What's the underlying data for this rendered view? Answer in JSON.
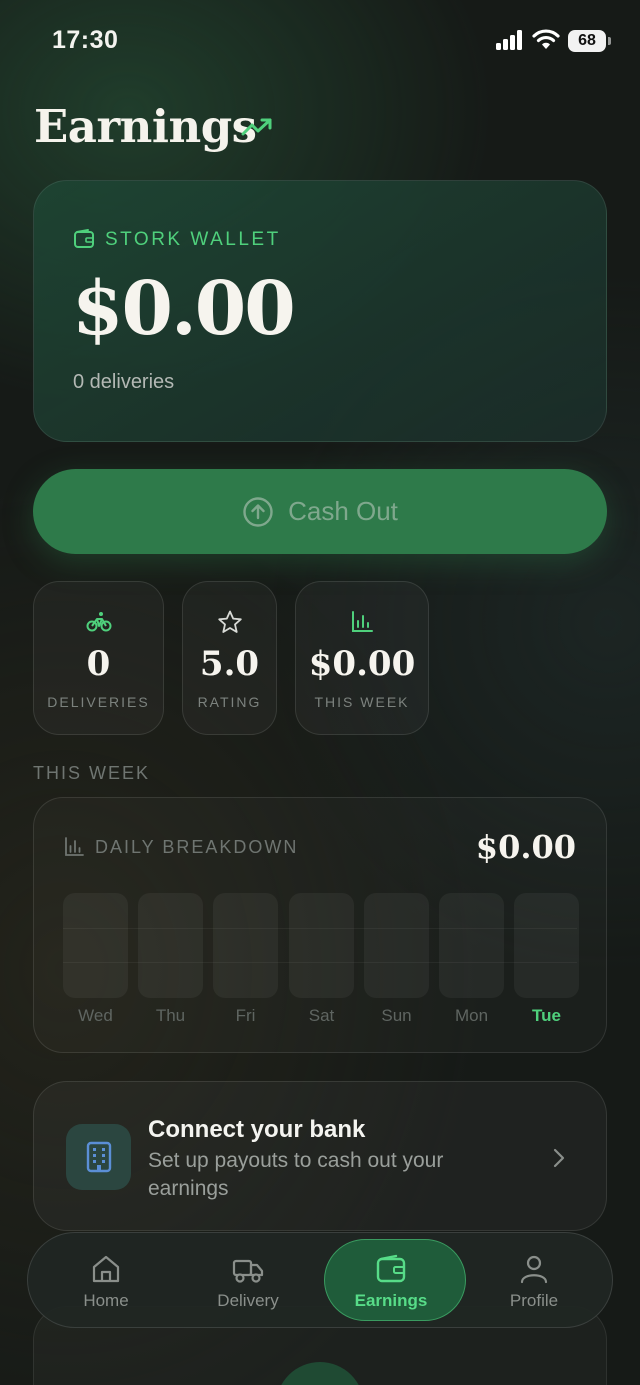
{
  "status_bar": {
    "time": "17:30",
    "battery": "68"
  },
  "header": {
    "title": "Earnings",
    "trend_icon": "trending-up-icon"
  },
  "wallet": {
    "label": "STORK WALLET",
    "amount": "$0.00",
    "deliveries": "0 deliveries",
    "icon": "wallet-icon"
  },
  "cash_out": {
    "label": "Cash Out",
    "icon": "arrow-up-circle-icon"
  },
  "stats": [
    {
      "icon": "bicycle-icon",
      "value": "0",
      "label": "DELIVERIES"
    },
    {
      "icon": "star-icon",
      "value": "5.0",
      "label": "RATING"
    },
    {
      "icon": "bar-chart-icon",
      "value": "$0.00",
      "label": "THIS WEEK"
    }
  ],
  "section_label": "THIS WEEK",
  "breakdown": {
    "title": "DAILY BREAKDOWN",
    "total": "$0.00",
    "days": [
      "Wed",
      "Thu",
      "Fri",
      "Sat",
      "Sun",
      "Mon",
      "Tue"
    ],
    "values": [
      0,
      0,
      0,
      0,
      0,
      0,
      0
    ],
    "today": "Tue"
  },
  "bank": {
    "title": "Connect your bank",
    "subtitle": "Set up payouts to cash out your earnings",
    "icon": "building-icon"
  },
  "nav": {
    "items": [
      {
        "label": "Home",
        "icon": "home-icon"
      },
      {
        "label": "Delivery",
        "icon": "delivery-truck-icon"
      },
      {
        "label": "Earnings",
        "icon": "wallet-icon"
      },
      {
        "label": "Profile",
        "icon": "user-icon"
      }
    ],
    "active": "Earnings"
  },
  "colors": {
    "accent": "#4fd07c",
    "button": "#2e7a4a",
    "background": "#161a17"
  }
}
